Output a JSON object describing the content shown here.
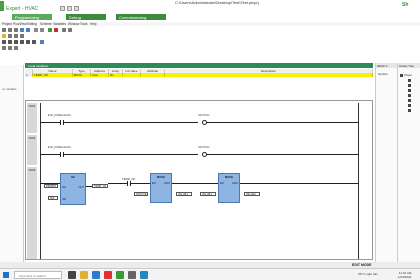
{
  "window": {
    "title": "C:\\Users\\Administrator\\Desktop\\Test\\Test.plcprj",
    "app_name": "Expert - HVAC",
    "corner_logo": "Sh"
  },
  "ribbon": {
    "tabs": [
      {
        "label": "Programming",
        "active": true
      },
      {
        "label": "Debug",
        "active": false
      },
      {
        "label": "Commissioning",
        "active": false
      }
    ]
  },
  "menu": [
    "Project",
    "Pou/View",
    "Editing",
    "Scheme",
    "Variables",
    "Window",
    "Tools",
    "Help"
  ],
  "left_panel": {
    "label": "oc variable"
  },
  "variables": {
    "header": "Local variables",
    "columns": [
      "Name",
      "Type",
      "Address",
      "Array",
      "Init value",
      "Attribute",
      "Description"
    ],
    "rows": [
      {
        "num": "1",
        "name": "TEMP_OK",
        "type": "BOOL",
        "address": "Auto",
        "array": "No",
        "init": "",
        "attribute": "",
        "description": ""
      }
    ]
  },
  "ladder": {
    "rungs": [
      {
        "num": "0001",
        "contact": "Enb_FGSEnAct10",
        "coil": "SICTIGN"
      },
      {
        "num": "0002",
        "contact": "Enb_FGSEnAct10",
        "coil": "SICTIGN"
      },
      {
        "num": "0003"
      }
    ],
    "blocks": [
      {
        "name": "GE",
        "in1": "IN1",
        "in2": "IN2",
        "out": "OUT",
        "var_in1": "PRNSP1",
        "var_in2": "500",
        "var_out": "TEMP_OK"
      },
      {
        "name": "MOVE",
        "in": "EN",
        "out": "ENO",
        "var_in": "SPVOTE",
        "var_out": "VALUE1"
      },
      {
        "name": "MOVE",
        "in": "EN",
        "out": "ENO",
        "var_in": "VALUE1",
        "var_out": "VALUE2"
      }
    ],
    "mid_contact": "TEMP_OK"
  },
  "right_panels": {
    "panel1": {
      "title": "Watch X",
      "sub": "Symbol"
    },
    "panel2": {
      "title": "Library Tree",
      "items": [
        "Projec",
        "",
        "",
        "",
        "",
        "",
        "",
        ""
      ]
    }
  },
  "status": {
    "mode": "EDIT MODE"
  },
  "taskbar": {
    "search": "Type here to search",
    "tray": "29°C  Light rain",
    "time": "11:01 AM",
    "date": "1/24/2024"
  }
}
